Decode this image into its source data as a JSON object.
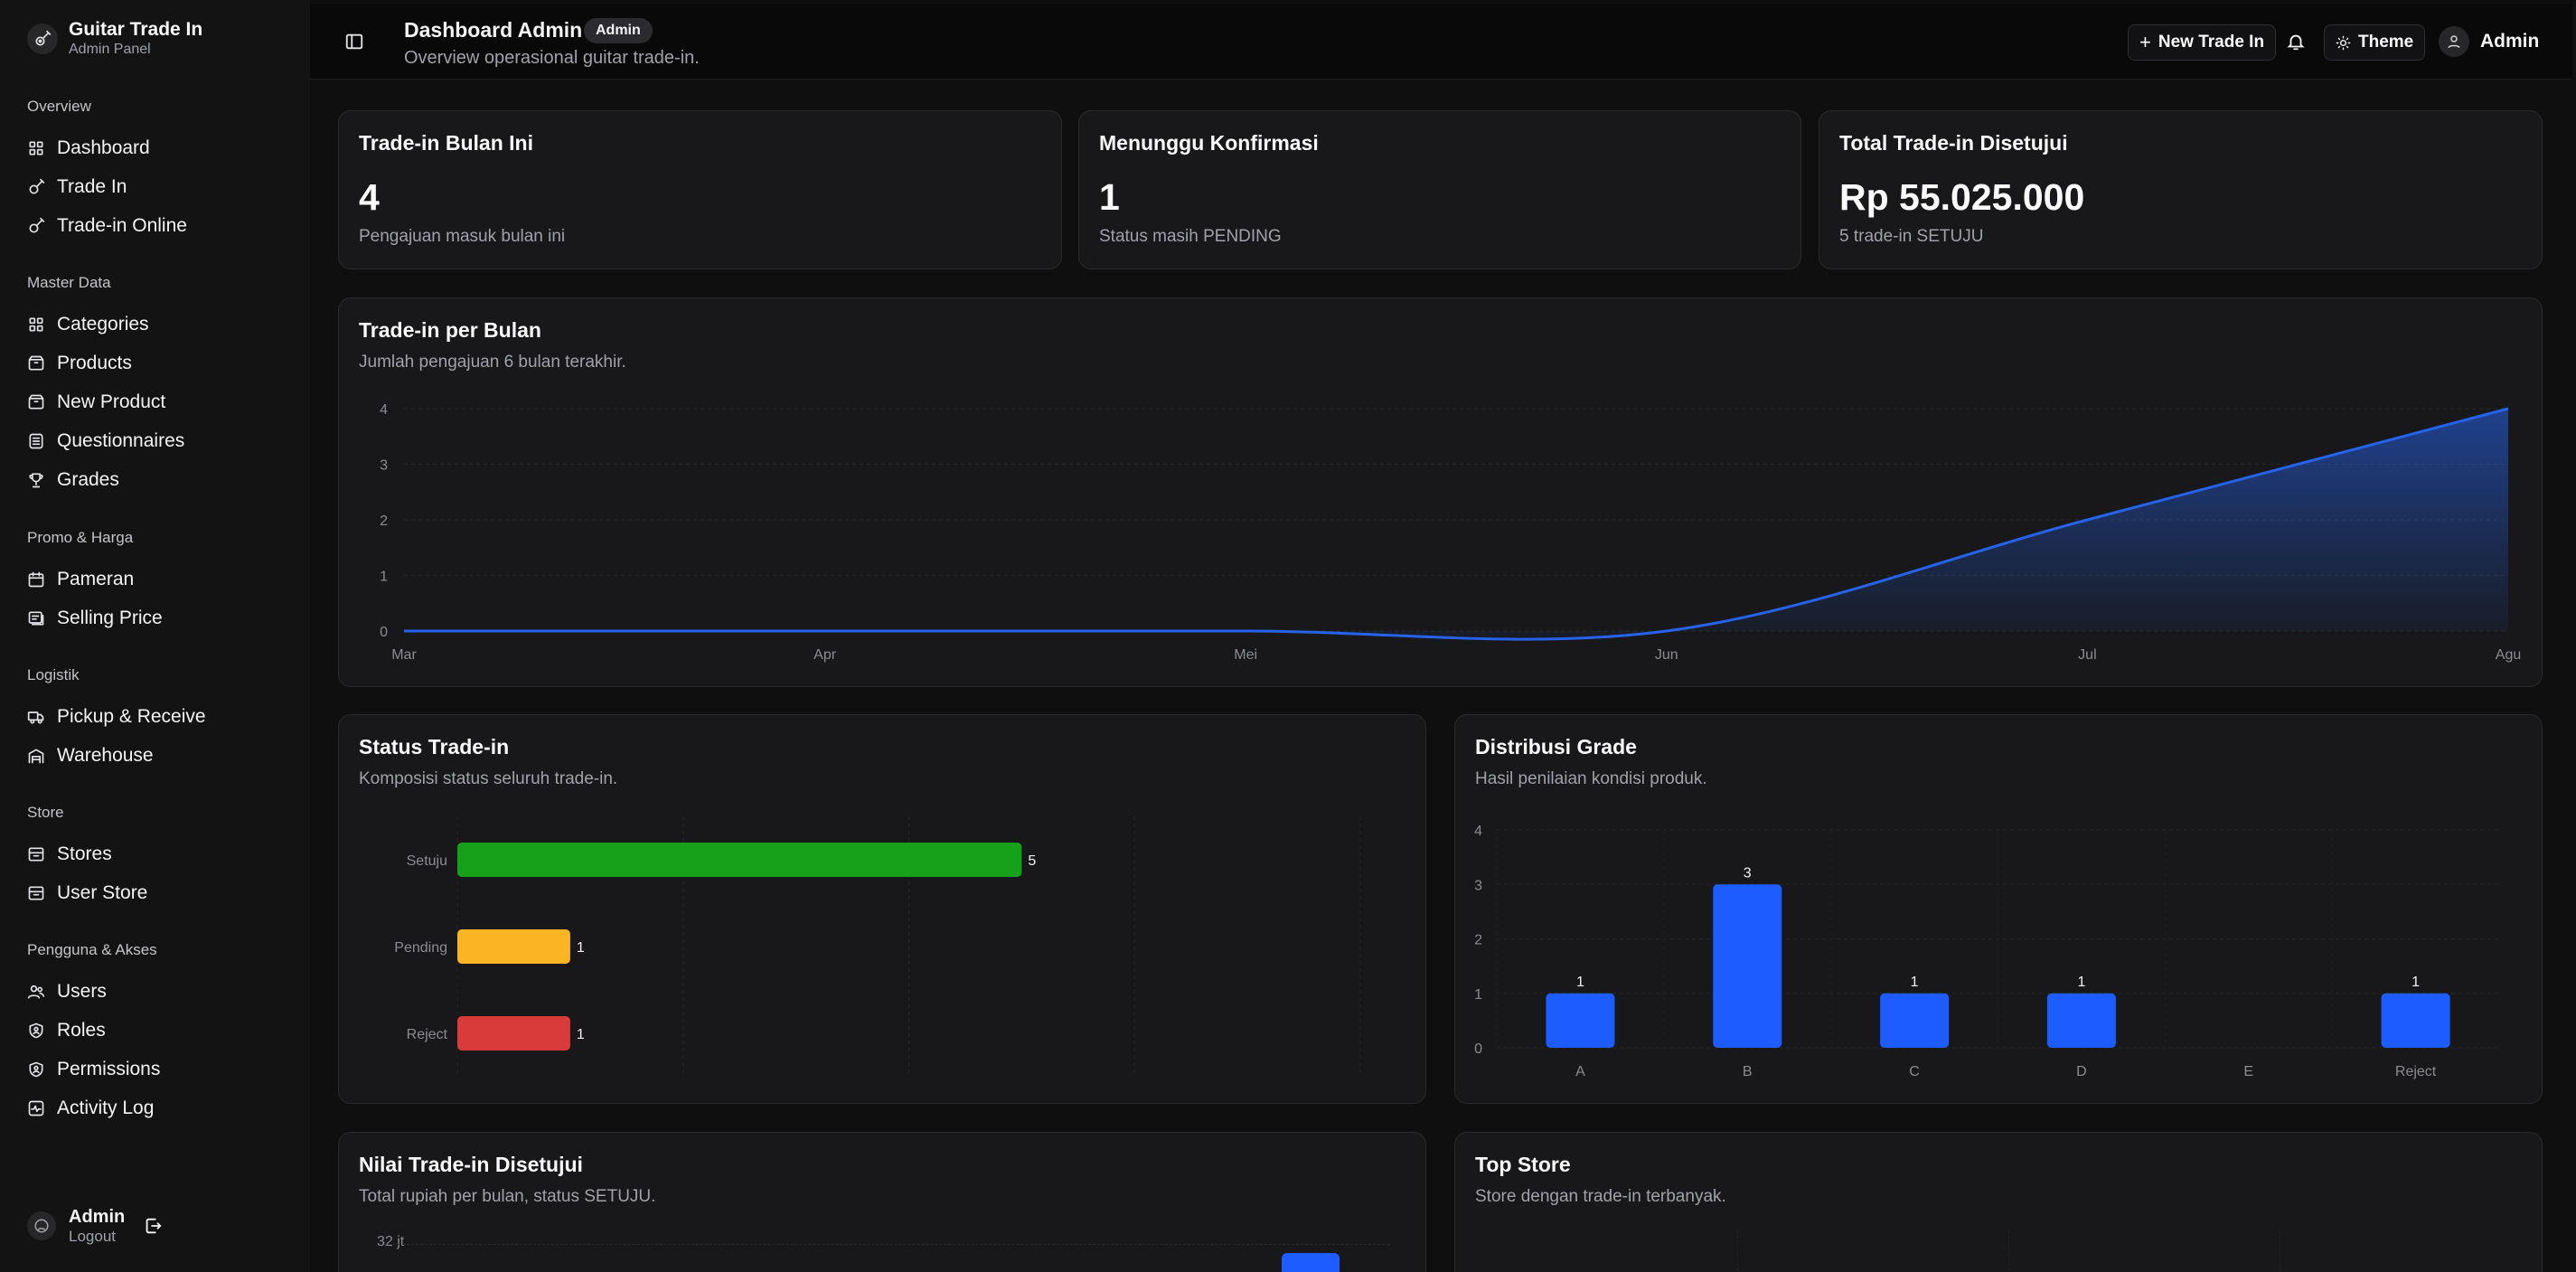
{
  "brand": {
    "title": "Guitar Trade In",
    "subtitle": "Admin Panel"
  },
  "sidebar": {
    "groups": [
      {
        "label": "Overview",
        "items": [
          {
            "label": "Dashboard",
            "icon": "grid-icon"
          },
          {
            "label": "Trade In",
            "icon": "guitar-icon"
          },
          {
            "label": "Trade-in Online",
            "icon": "guitar-icon"
          }
        ]
      },
      {
        "label": "Master Data",
        "items": [
          {
            "label": "Categories",
            "icon": "grid-icon"
          },
          {
            "label": "Products",
            "icon": "box-icon"
          },
          {
            "label": "New Product",
            "icon": "box-icon"
          },
          {
            "label": "Questionnaires",
            "icon": "list-icon"
          },
          {
            "label": "Grades",
            "icon": "trophy-icon"
          }
        ]
      },
      {
        "label": "Promo & Harga",
        "items": [
          {
            "label": "Pameran",
            "icon": "calendar-icon"
          },
          {
            "label": "Selling Price",
            "icon": "receipt-icon"
          }
        ]
      },
      {
        "label": "Logistik",
        "items": [
          {
            "label": "Pickup & Receive",
            "icon": "truck-icon"
          },
          {
            "label": "Warehouse",
            "icon": "warehouse-icon"
          }
        ]
      },
      {
        "label": "Store",
        "items": [
          {
            "label": "Stores",
            "icon": "store-icon"
          },
          {
            "label": "User Store",
            "icon": "store-icon"
          }
        ]
      },
      {
        "label": "Pengguna & Akses",
        "items": [
          {
            "label": "Users",
            "icon": "users-icon"
          },
          {
            "label": "Roles",
            "icon": "shield-icon"
          },
          {
            "label": "Permissions",
            "icon": "shield-icon"
          },
          {
            "label": "Activity Log",
            "icon": "activity-icon"
          }
        ]
      }
    ],
    "footer": {
      "name": "Admin",
      "logout": "Logout"
    }
  },
  "header": {
    "title": "Dashboard Admin",
    "badge": "Admin",
    "subtitle": "Overview operasional guitar trade-in.",
    "new_trade_in": "New Trade In",
    "theme": "Theme",
    "user": "Admin"
  },
  "stats": [
    {
      "title": "Trade-in Bulan Ini",
      "value": "4",
      "note": "Pengajuan masuk bulan ini"
    },
    {
      "title": "Menunggu Konfirmasi",
      "value": "1",
      "note": "Status masih PENDING"
    },
    {
      "title": "Total Trade-in Disetujui",
      "value": "Rp 55.025.000",
      "note": "5 trade-in SETUJU"
    }
  ],
  "monthly": {
    "title": "Trade-in per Bulan",
    "subtitle": "Jumlah pengajuan 6 bulan terakhir.",
    "chart_data": {
      "type": "area",
      "x": [
        "Mar",
        "Apr",
        "Mei",
        "Jun",
        "Jul",
        "Agu"
      ],
      "values": [
        0,
        0,
        0,
        0,
        2,
        4
      ],
      "ylim": [
        0,
        4
      ],
      "yticks": [
        0,
        1,
        2,
        3,
        4
      ],
      "color": "#2563eb"
    }
  },
  "status": {
    "title": "Status Trade-in",
    "subtitle": "Komposisi status seluruh trade-in.",
    "chart_data": {
      "type": "bar",
      "orientation": "horizontal",
      "categories": [
        "Setuju",
        "Pending",
        "Reject"
      ],
      "values": [
        5,
        1,
        1
      ],
      "colors": [
        "#16a11a",
        "#fbb524",
        "#d93a3a"
      ],
      "xlim": [
        0,
        8
      ]
    }
  },
  "grade": {
    "title": "Distribusi Grade",
    "subtitle": "Hasil penilaian kondisi produk.",
    "chart_data": {
      "type": "bar",
      "categories": [
        "A",
        "B",
        "C",
        "D",
        "E",
        "Reject"
      ],
      "values": [
        1,
        3,
        1,
        1,
        0,
        1
      ],
      "ylim": [
        0,
        4
      ],
      "yticks": [
        0,
        1,
        2,
        3,
        4
      ],
      "color": "#1d5cff"
    }
  },
  "approved_value": {
    "title": "Nilai Trade-in Disetujui",
    "subtitle": "Total rupiah per bulan, status SETUJU.",
    "ytick_top": "32 jt"
  },
  "top_store": {
    "title": "Top Store",
    "subtitle": "Store dengan trade-in terbanyak."
  }
}
